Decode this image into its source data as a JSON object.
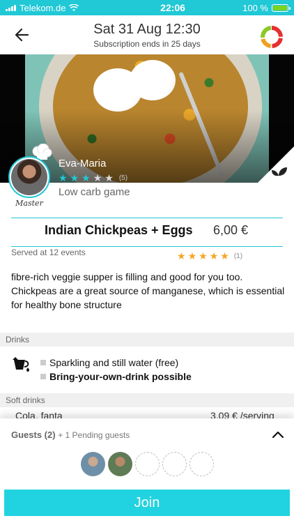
{
  "status_bar": {
    "carrier": "Telekom.de",
    "time": "22:06",
    "battery": "100 %"
  },
  "header": {
    "title": "Sat 31 Aug 12:30",
    "subtitle": "Subscription ends in 25 days"
  },
  "host": {
    "name": "Eva-Maria",
    "badge": "Master",
    "rating": 3,
    "rating_count": "(5)",
    "event_name": "Low carb game"
  },
  "dish": {
    "title": "Indian Chickpeas + Eggs",
    "price": "6,00 €",
    "served": "Served at 12 events",
    "rating": 5,
    "rating_count": "(1)",
    "description": "fibre-rich veggie supper is filling and good for you too. Chickpeas are a great source of manganese, which is essential for healthy bone structure"
  },
  "drinks": {
    "heading": "Drinks",
    "items": [
      {
        "label": "Sparkling and still water (free)",
        "bold": false
      },
      {
        "label": "Bring-your-own-drink possible",
        "bold": true
      }
    ]
  },
  "soft_drinks": {
    "heading": "Soft drinks",
    "item": "Cola, fanta",
    "price": "3,09 € /serving"
  },
  "guests": {
    "label": "Guests (2)",
    "pending": "+ 1 Pending guests",
    "filled": 2,
    "total_slots": 5
  },
  "join_label": "Join",
  "colors": {
    "accent": "#21c8d6",
    "star": "#f5a623",
    "button": "#21d3e0"
  }
}
